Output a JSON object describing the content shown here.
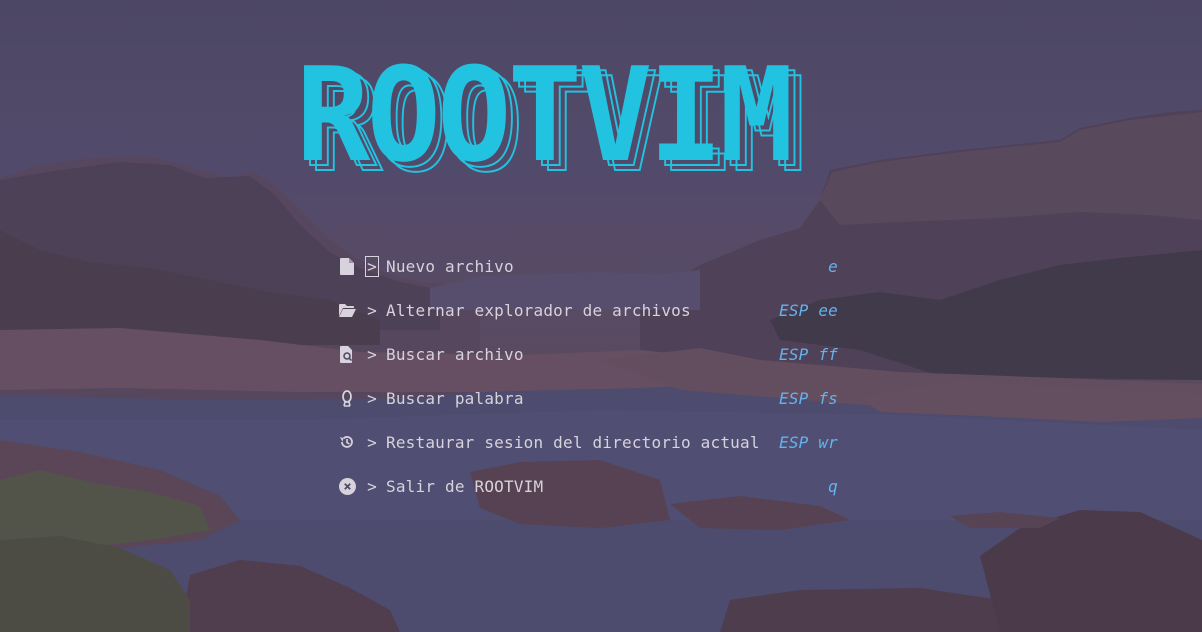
{
  "app": {
    "banner_text": "ROOTVIM",
    "accent_color": "#22c3e0",
    "key_color": "#63b3f0",
    "text_color": "#d7d2dc"
  },
  "menu": {
    "caret": ">",
    "items": [
      {
        "icon": "file-icon",
        "label": "Nuevo archivo",
        "key": "e"
      },
      {
        "icon": "folder-open-icon",
        "label": "Alternar explorador de archivos",
        "key": "ESP ee"
      },
      {
        "icon": "file-search-icon",
        "label": "Buscar archivo",
        "key": "ESP ff"
      },
      {
        "icon": "search-word-icon",
        "label": "Buscar palabra",
        "key": "ESP fs"
      },
      {
        "icon": "restore-session-icon",
        "label": "Restaurar sesion del directorio actual",
        "key": "ESP wr"
      },
      {
        "icon": "close-circle-icon",
        "label": "Salir de ROOTVIM",
        "key": "q"
      }
    ]
  }
}
